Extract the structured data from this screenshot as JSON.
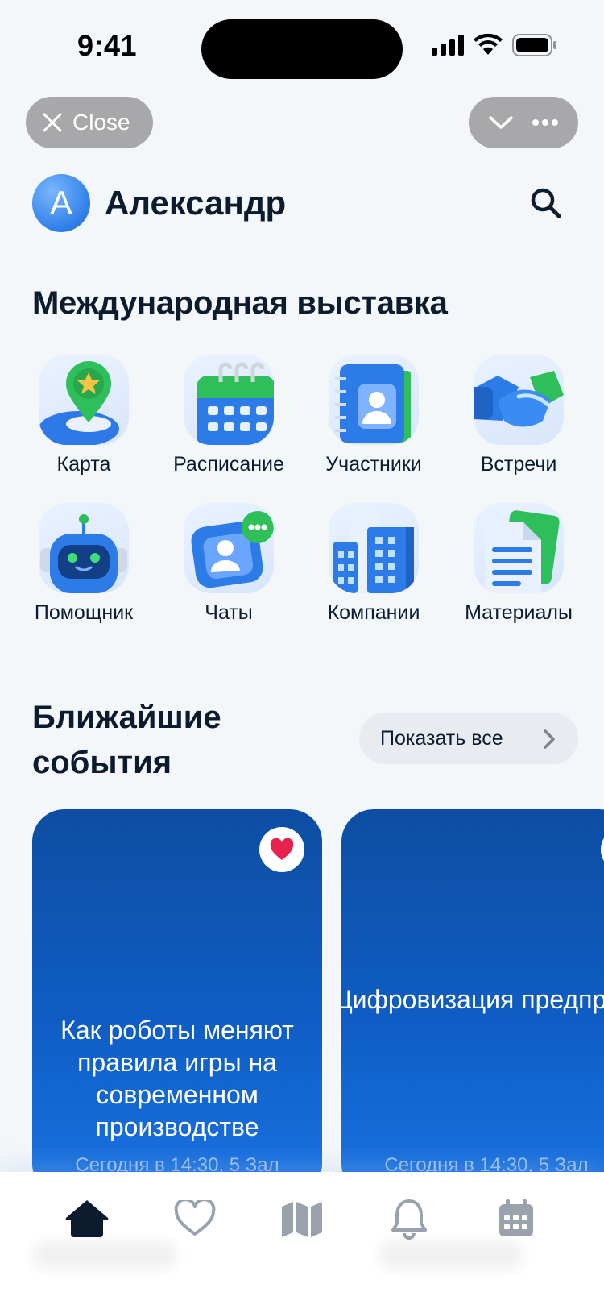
{
  "status_bar": {
    "time": "9:41"
  },
  "top_controls": {
    "close_label": "Close"
  },
  "header": {
    "avatar_letter": "А",
    "user_name": "Александр"
  },
  "section": {
    "title": "Международная выставка"
  },
  "tiles": [
    {
      "label": "Карта",
      "icon": "map-pin-icon"
    },
    {
      "label": "Расписание",
      "icon": "calendar-icon"
    },
    {
      "label": "Участники",
      "icon": "contacts-book-icon"
    },
    {
      "label": "Встречи",
      "icon": "handshake-icon"
    },
    {
      "label": "Помощник",
      "icon": "robot-icon"
    },
    {
      "label": "Чаты",
      "icon": "chat-icon"
    },
    {
      "label": "Компании",
      "icon": "buildings-icon"
    },
    {
      "label": "Материалы",
      "icon": "documents-icon"
    }
  ],
  "events": {
    "title": "Ближайшие события",
    "show_all": "Показать все",
    "cards": [
      {
        "title": "Как роботы меняют правила игры на современном производстве",
        "meta": "Сегодня в 14:30, 5 Зал",
        "favorited": true
      },
      {
        "title": "Цифровизация предприятий: системный подход к модернизации бизнес-процессов",
        "meta": "Сегодня в 14:30, 5 Зал",
        "favorited": false
      }
    ]
  },
  "tabbar": {
    "tabs": [
      "home-icon",
      "heart-icon",
      "map-icon",
      "bell-icon",
      "calendar-icon"
    ],
    "active": "home-icon"
  },
  "colors": {
    "accent": "#1a6fe0",
    "card_dark": "#0d4ea3",
    "favorite": "#e8224f"
  }
}
